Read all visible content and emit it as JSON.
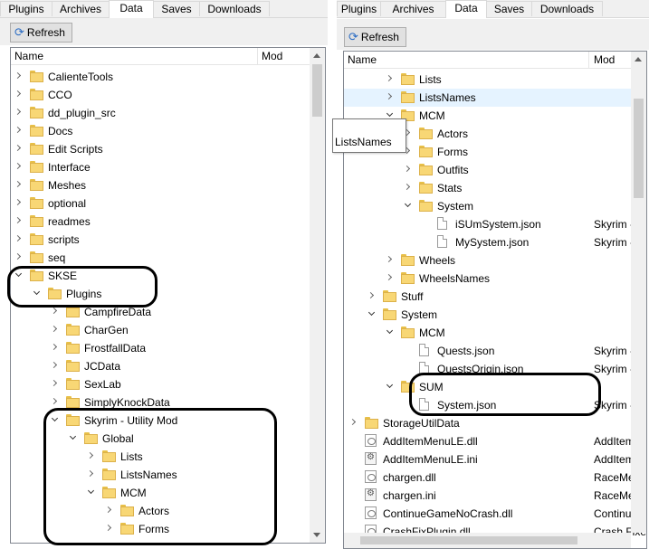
{
  "tabs": [
    "Plugins",
    "Archives",
    "Data",
    "Saves",
    "Downloads"
  ],
  "active_tab": "Data",
  "toolbar": {
    "refresh_label": "Refresh"
  },
  "columns": {
    "name": "Name",
    "mod": "Mod"
  },
  "left_rows": [
    {
      "label": "CalienteTools",
      "depth": 0,
      "expander": "collapsed",
      "icon": "folder-icon"
    },
    {
      "label": "CCO",
      "depth": 0,
      "expander": "collapsed",
      "icon": "folder-icon"
    },
    {
      "label": "dd_plugin_src",
      "depth": 0,
      "expander": "collapsed",
      "icon": "folder-icon"
    },
    {
      "label": "Docs",
      "depth": 0,
      "expander": "collapsed",
      "icon": "folder-icon"
    },
    {
      "label": "Edit Scripts",
      "depth": 0,
      "expander": "collapsed",
      "icon": "folder-icon"
    },
    {
      "label": "Interface",
      "depth": 0,
      "expander": "collapsed",
      "icon": "folder-icon"
    },
    {
      "label": "Meshes",
      "depth": 0,
      "expander": "collapsed",
      "icon": "folder-icon"
    },
    {
      "label": "optional",
      "depth": 0,
      "expander": "collapsed",
      "icon": "folder-icon"
    },
    {
      "label": "readmes",
      "depth": 0,
      "expander": "collapsed",
      "icon": "folder-icon"
    },
    {
      "label": "scripts",
      "depth": 0,
      "expander": "collapsed",
      "icon": "folder-icon"
    },
    {
      "label": "seq",
      "depth": 0,
      "expander": "collapsed",
      "icon": "folder-icon"
    },
    {
      "label": "SKSE",
      "depth": 0,
      "expander": "expanded",
      "icon": "folder-icon"
    },
    {
      "label": "Plugins",
      "depth": 1,
      "expander": "expanded",
      "icon": "folder-icon"
    },
    {
      "label": "CampfireData",
      "depth": 2,
      "expander": "collapsed",
      "icon": "folder-icon"
    },
    {
      "label": "CharGen",
      "depth": 2,
      "expander": "collapsed",
      "icon": "folder-icon"
    },
    {
      "label": "FrostfallData",
      "depth": 2,
      "expander": "collapsed",
      "icon": "folder-icon"
    },
    {
      "label": "JCData",
      "depth": 2,
      "expander": "collapsed",
      "icon": "folder-icon"
    },
    {
      "label": "SexLab",
      "depth": 2,
      "expander": "collapsed",
      "icon": "folder-icon"
    },
    {
      "label": "SimplyKnockData",
      "depth": 2,
      "expander": "collapsed",
      "icon": "folder-icon"
    },
    {
      "label": "Skyrim - Utility Mod",
      "depth": 2,
      "expander": "expanded",
      "icon": "folder-icon"
    },
    {
      "label": "Global",
      "depth": 3,
      "expander": "expanded",
      "icon": "folder-icon"
    },
    {
      "label": "Lists",
      "depth": 4,
      "expander": "collapsed",
      "icon": "folder-icon"
    },
    {
      "label": "ListsNames",
      "depth": 4,
      "expander": "collapsed",
      "icon": "folder-icon"
    },
    {
      "label": "MCM",
      "depth": 4,
      "expander": "expanded",
      "icon": "folder-icon"
    },
    {
      "label": "Actors",
      "depth": 5,
      "expander": "collapsed",
      "icon": "folder-icon"
    },
    {
      "label": "Forms",
      "depth": 5,
      "expander": "collapsed",
      "icon": "folder-icon"
    }
  ],
  "right_rows": [
    {
      "label": "Lists",
      "mod": "",
      "depth": 4,
      "expander": "collapsed",
      "icon": "folder-icon"
    },
    {
      "label": "ListsNames",
      "mod": "",
      "depth": 4,
      "expander": "collapsed",
      "icon": "folder-icon",
      "selected": true
    },
    {
      "label": "MCM",
      "mod": "",
      "depth": 4,
      "expander": "expanded",
      "icon": "folder-icon"
    },
    {
      "label": "Actors",
      "mod": "",
      "depth": 5,
      "expander": "collapsed",
      "icon": "folder-icon"
    },
    {
      "label": "Forms",
      "mod": "",
      "depth": 5,
      "expander": "collapsed",
      "icon": "folder-icon"
    },
    {
      "label": "Outfits",
      "mod": "",
      "depth": 5,
      "expander": "collapsed",
      "icon": "folder-icon"
    },
    {
      "label": "Stats",
      "mod": "",
      "depth": 5,
      "expander": "collapsed",
      "icon": "folder-icon"
    },
    {
      "label": "System",
      "mod": "",
      "depth": 5,
      "expander": "expanded",
      "icon": "folder-icon"
    },
    {
      "label": "iSUmSystem.json",
      "mod": "Skyrim - U",
      "depth": 6,
      "expander": "none",
      "icon": "file-icon"
    },
    {
      "label": "MySystem.json",
      "mod": "Skyrim - U",
      "depth": 6,
      "expander": "none",
      "icon": "file-icon"
    },
    {
      "label": "Wheels",
      "mod": "",
      "depth": 4,
      "expander": "collapsed",
      "icon": "folder-icon"
    },
    {
      "label": "WheelsNames",
      "mod": "",
      "depth": 4,
      "expander": "collapsed",
      "icon": "folder-icon"
    },
    {
      "label": "Stuff",
      "mod": "",
      "depth": 3,
      "expander": "collapsed",
      "icon": "folder-icon"
    },
    {
      "label": "System",
      "mod": "",
      "depth": 3,
      "expander": "expanded",
      "icon": "folder-icon"
    },
    {
      "label": "MCM",
      "mod": "",
      "depth": 4,
      "expander": "expanded",
      "icon": "folder-icon"
    },
    {
      "label": "Quests.json",
      "mod": "Skyrim - U",
      "depth": 5,
      "expander": "none",
      "icon": "file-icon"
    },
    {
      "label": "QuestsOrigin.json",
      "mod": "Skyrim - U",
      "depth": 5,
      "expander": "none",
      "icon": "file-icon"
    },
    {
      "label": "SUM",
      "mod": "",
      "depth": 4,
      "expander": "expanded",
      "icon": "folder-icon"
    },
    {
      "label": "System.json",
      "mod": "Skyrim - U",
      "depth": 5,
      "expander": "none",
      "icon": "file-icon"
    },
    {
      "label": "StorageUtilData",
      "mod": "",
      "depth": 2,
      "expander": "collapsed",
      "icon": "folder-icon"
    },
    {
      "label": "AddItemMenuLE.dll",
      "mod": "AddItemM",
      "depth": 2,
      "expander": "none",
      "icon": "dll-icon"
    },
    {
      "label": "AddItemMenuLE.ini",
      "mod": "AddItemM",
      "depth": 2,
      "expander": "none",
      "icon": "settings-file-icon"
    },
    {
      "label": "chargen.dll",
      "mod": "RaceMenu",
      "depth": 2,
      "expander": "none",
      "icon": "dll-icon"
    },
    {
      "label": "chargen.ini",
      "mod": "RaceMenu",
      "depth": 2,
      "expander": "none",
      "icon": "settings-file-icon"
    },
    {
      "label": "ContinueGameNoCrash.dll",
      "mod": "Continue C",
      "depth": 2,
      "expander": "none",
      "icon": "dll-icon"
    },
    {
      "label": "CrashFixPlugin.dll",
      "mod": "Crash Fixe",
      "depth": 2,
      "expander": "none",
      "icon": "dll-icon"
    }
  ],
  "tooltip": {
    "text": "ListsNames"
  }
}
